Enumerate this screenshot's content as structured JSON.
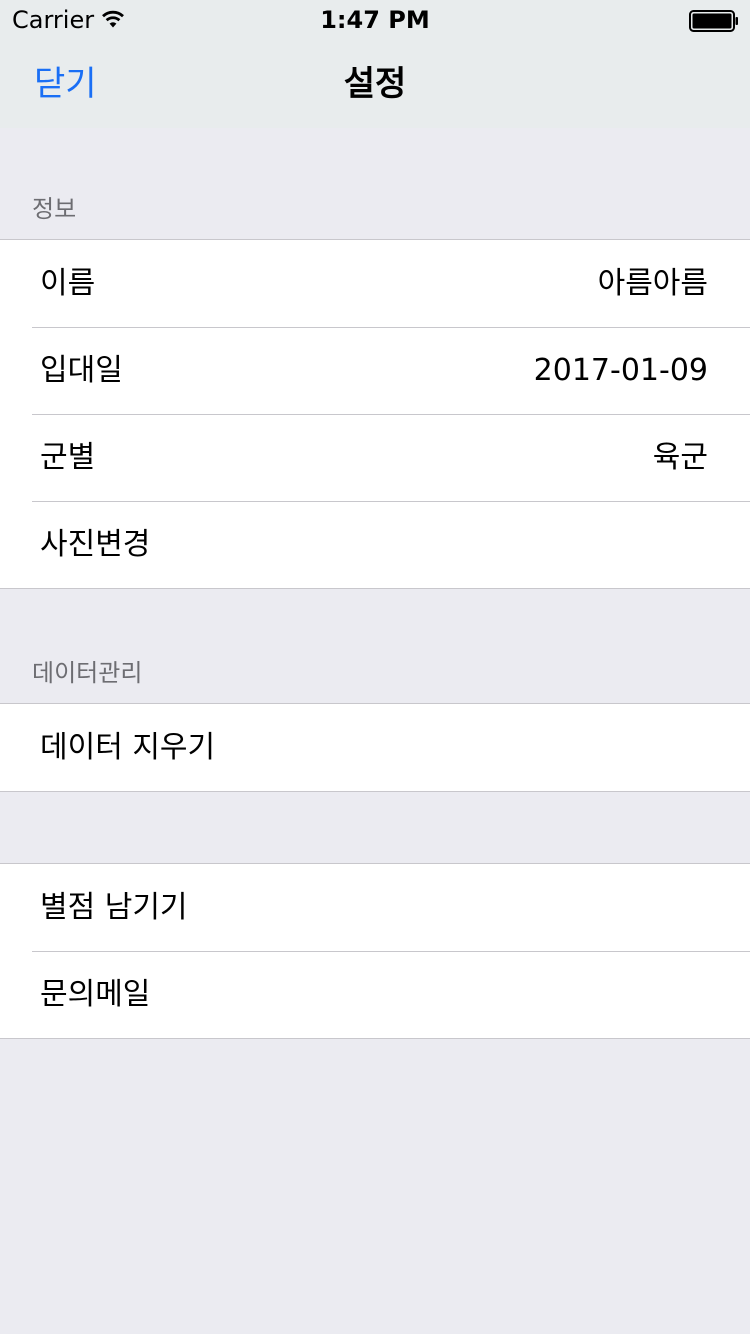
{
  "status_bar": {
    "carrier": "Carrier",
    "time": "1:47 PM",
    "wifi_icon": "wifi-icon",
    "battery_icon": "battery-full-icon"
  },
  "nav": {
    "close_label": "닫기",
    "title": "설정"
  },
  "sections": {
    "info": {
      "header": "정보",
      "rows": [
        {
          "label": "이름",
          "value": "아름아름"
        },
        {
          "label": "입대일",
          "value": "2017-01-09"
        },
        {
          "label": "군별",
          "value": "육군"
        },
        {
          "label": "사진변경"
        }
      ]
    },
    "data_management": {
      "header": "데이터관리",
      "rows": [
        {
          "label": "데이터 지우기"
        }
      ]
    },
    "misc": {
      "rows": [
        {
          "label": "별점 남기기"
        },
        {
          "label": "문의메일"
        }
      ]
    }
  },
  "colors": {
    "accent": "#1a6ff5",
    "background": "#ebebf1",
    "header_text": "#6d6d72",
    "separator": "#c8c7cc"
  }
}
